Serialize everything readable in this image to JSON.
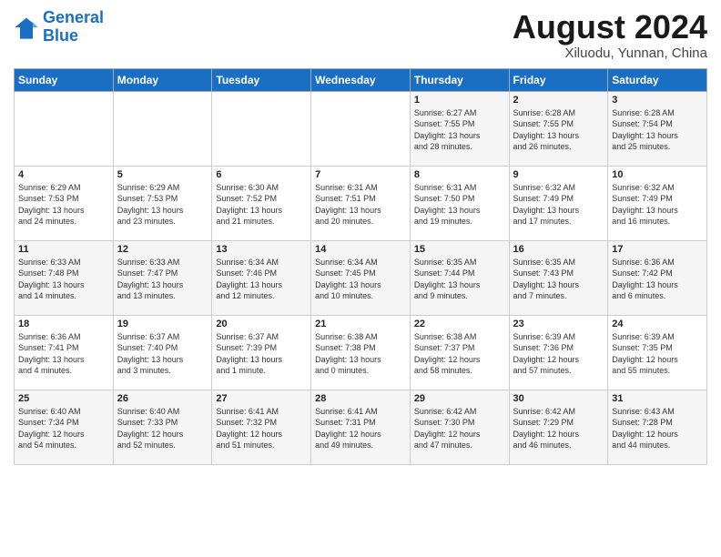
{
  "logo": {
    "line1": "General",
    "line2": "Blue"
  },
  "title": "August 2024",
  "location": "Xiluodu, Yunnan, China",
  "days_of_week": [
    "Sunday",
    "Monday",
    "Tuesday",
    "Wednesday",
    "Thursday",
    "Friday",
    "Saturday"
  ],
  "weeks": [
    [
      {
        "num": "",
        "info": ""
      },
      {
        "num": "",
        "info": ""
      },
      {
        "num": "",
        "info": ""
      },
      {
        "num": "",
        "info": ""
      },
      {
        "num": "1",
        "info": "Sunrise: 6:27 AM\nSunset: 7:55 PM\nDaylight: 13 hours\nand 28 minutes."
      },
      {
        "num": "2",
        "info": "Sunrise: 6:28 AM\nSunset: 7:55 PM\nDaylight: 13 hours\nand 26 minutes."
      },
      {
        "num": "3",
        "info": "Sunrise: 6:28 AM\nSunset: 7:54 PM\nDaylight: 13 hours\nand 25 minutes."
      }
    ],
    [
      {
        "num": "4",
        "info": "Sunrise: 6:29 AM\nSunset: 7:53 PM\nDaylight: 13 hours\nand 24 minutes."
      },
      {
        "num": "5",
        "info": "Sunrise: 6:29 AM\nSunset: 7:53 PM\nDaylight: 13 hours\nand 23 minutes."
      },
      {
        "num": "6",
        "info": "Sunrise: 6:30 AM\nSunset: 7:52 PM\nDaylight: 13 hours\nand 21 minutes."
      },
      {
        "num": "7",
        "info": "Sunrise: 6:31 AM\nSunset: 7:51 PM\nDaylight: 13 hours\nand 20 minutes."
      },
      {
        "num": "8",
        "info": "Sunrise: 6:31 AM\nSunset: 7:50 PM\nDaylight: 13 hours\nand 19 minutes."
      },
      {
        "num": "9",
        "info": "Sunrise: 6:32 AM\nSunset: 7:49 PM\nDaylight: 13 hours\nand 17 minutes."
      },
      {
        "num": "10",
        "info": "Sunrise: 6:32 AM\nSunset: 7:49 PM\nDaylight: 13 hours\nand 16 minutes."
      }
    ],
    [
      {
        "num": "11",
        "info": "Sunrise: 6:33 AM\nSunset: 7:48 PM\nDaylight: 13 hours\nand 14 minutes."
      },
      {
        "num": "12",
        "info": "Sunrise: 6:33 AM\nSunset: 7:47 PM\nDaylight: 13 hours\nand 13 minutes."
      },
      {
        "num": "13",
        "info": "Sunrise: 6:34 AM\nSunset: 7:46 PM\nDaylight: 13 hours\nand 12 minutes."
      },
      {
        "num": "14",
        "info": "Sunrise: 6:34 AM\nSunset: 7:45 PM\nDaylight: 13 hours\nand 10 minutes."
      },
      {
        "num": "15",
        "info": "Sunrise: 6:35 AM\nSunset: 7:44 PM\nDaylight: 13 hours\nand 9 minutes."
      },
      {
        "num": "16",
        "info": "Sunrise: 6:35 AM\nSunset: 7:43 PM\nDaylight: 13 hours\nand 7 minutes."
      },
      {
        "num": "17",
        "info": "Sunrise: 6:36 AM\nSunset: 7:42 PM\nDaylight: 13 hours\nand 6 minutes."
      }
    ],
    [
      {
        "num": "18",
        "info": "Sunrise: 6:36 AM\nSunset: 7:41 PM\nDaylight: 13 hours\nand 4 minutes."
      },
      {
        "num": "19",
        "info": "Sunrise: 6:37 AM\nSunset: 7:40 PM\nDaylight: 13 hours\nand 3 minutes."
      },
      {
        "num": "20",
        "info": "Sunrise: 6:37 AM\nSunset: 7:39 PM\nDaylight: 13 hours\nand 1 minute."
      },
      {
        "num": "21",
        "info": "Sunrise: 6:38 AM\nSunset: 7:38 PM\nDaylight: 13 hours\nand 0 minutes."
      },
      {
        "num": "22",
        "info": "Sunrise: 6:38 AM\nSunset: 7:37 PM\nDaylight: 12 hours\nand 58 minutes."
      },
      {
        "num": "23",
        "info": "Sunrise: 6:39 AM\nSunset: 7:36 PM\nDaylight: 12 hours\nand 57 minutes."
      },
      {
        "num": "24",
        "info": "Sunrise: 6:39 AM\nSunset: 7:35 PM\nDaylight: 12 hours\nand 55 minutes."
      }
    ],
    [
      {
        "num": "25",
        "info": "Sunrise: 6:40 AM\nSunset: 7:34 PM\nDaylight: 12 hours\nand 54 minutes."
      },
      {
        "num": "26",
        "info": "Sunrise: 6:40 AM\nSunset: 7:33 PM\nDaylight: 12 hours\nand 52 minutes."
      },
      {
        "num": "27",
        "info": "Sunrise: 6:41 AM\nSunset: 7:32 PM\nDaylight: 12 hours\nand 51 minutes."
      },
      {
        "num": "28",
        "info": "Sunrise: 6:41 AM\nSunset: 7:31 PM\nDaylight: 12 hours\nand 49 minutes."
      },
      {
        "num": "29",
        "info": "Sunrise: 6:42 AM\nSunset: 7:30 PM\nDaylight: 12 hours\nand 47 minutes."
      },
      {
        "num": "30",
        "info": "Sunrise: 6:42 AM\nSunset: 7:29 PM\nDaylight: 12 hours\nand 46 minutes."
      },
      {
        "num": "31",
        "info": "Sunrise: 6:43 AM\nSunset: 7:28 PM\nDaylight: 12 hours\nand 44 minutes."
      }
    ]
  ]
}
